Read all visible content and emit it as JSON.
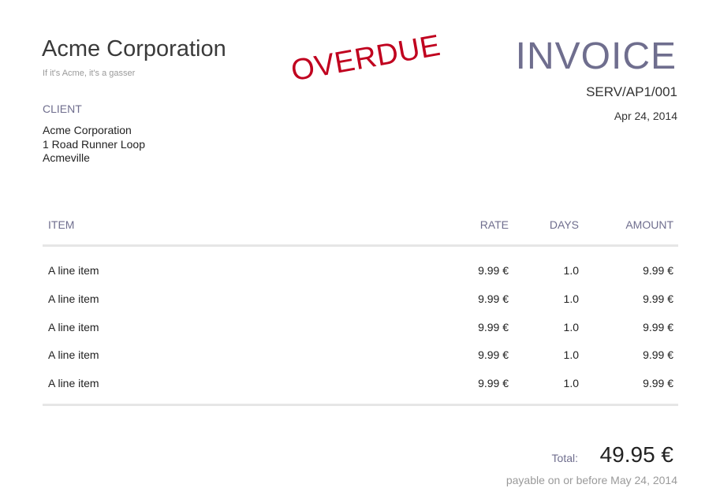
{
  "company": {
    "name": "Acme Corporation",
    "tagline": "If it's Acme, it's a gasser"
  },
  "stamp": {
    "text": "OVERDUE",
    "color": "#c0001e"
  },
  "invoice": {
    "title": "INVOICE",
    "number": "SERV/AP1/001",
    "date": "Apr 24, 2014"
  },
  "client": {
    "heading": "CLIENT",
    "name": "Acme Corporation",
    "street": "1 Road Runner Loop",
    "city": "Acmeville"
  },
  "table": {
    "headers": {
      "item": "ITEM",
      "rate": "RATE",
      "days": "DAYS",
      "amount": "AMOUNT"
    },
    "rows": [
      {
        "item": "A line item",
        "rate": "9.99 €",
        "days": "1.0",
        "amount": "9.99 €"
      },
      {
        "item": "A line item",
        "rate": "9.99 €",
        "days": "1.0",
        "amount": "9.99 €"
      },
      {
        "item": "A line item",
        "rate": "9.99 €",
        "days": "1.0",
        "amount": "9.99 €"
      },
      {
        "item": "A line item",
        "rate": "9.99 €",
        "days": "1.0",
        "amount": "9.99 €"
      },
      {
        "item": "A line item",
        "rate": "9.99 €",
        "days": "1.0",
        "amount": "9.99 €"
      }
    ]
  },
  "total": {
    "label": "Total:",
    "value": "49.95 €",
    "payable_note": "payable on or before May 24, 2014"
  },
  "colors": {
    "accent": "#6f6e8e",
    "overdue": "#c0001e",
    "divider": "#e6e6e6"
  }
}
